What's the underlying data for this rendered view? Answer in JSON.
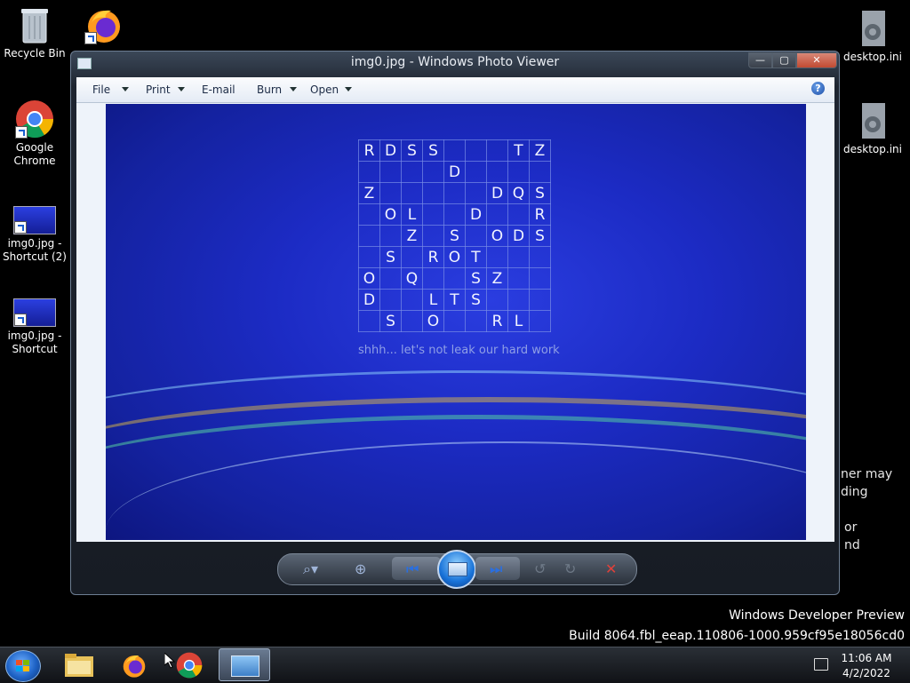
{
  "desktop": {
    "icons": [
      {
        "label": "Recycle Bin"
      },
      {
        "label": "Google Chrome"
      },
      {
        "label": "img0.jpg - Shortcut (2)"
      },
      {
        "label": "img0.jpg - Shortcut"
      },
      {
        "label": "desktop.ini"
      },
      {
        "label": "desktop.ini"
      }
    ],
    "background_fragments": [
      "ner may",
      "ding",
      "or",
      "nd"
    ],
    "watermark": {
      "line1": "Windows Developer Preview",
      "line2": "Build 8064.fbl_eeap.110806-1000.959cf95e18056cd0"
    }
  },
  "window": {
    "title": "img0.jpg - Windows Photo Viewer",
    "menu": [
      {
        "label": "File",
        "has_dropdown": true
      },
      {
        "label": "Print",
        "has_dropdown": true
      },
      {
        "label": "E-mail",
        "has_dropdown": false
      },
      {
        "label": "Burn",
        "has_dropdown": true
      },
      {
        "label": "Open",
        "has_dropdown": true
      }
    ],
    "help": "?",
    "controls": {
      "minimize": "—",
      "maximize": "▢",
      "close": "✕"
    }
  },
  "photo": {
    "grid": [
      [
        "R",
        "D",
        "S",
        "S",
        "",
        "",
        "",
        "T",
        "Z"
      ],
      [
        "",
        "",
        "",
        "",
        "D",
        "",
        "",
        "",
        ""
      ],
      [
        "Z",
        "",
        "",
        "",
        "",
        "",
        "D",
        "Q",
        "S"
      ],
      [
        "",
        "O",
        "L",
        "",
        "",
        "D",
        "",
        "",
        "R"
      ],
      [
        "",
        "",
        "Z",
        "",
        "S",
        "",
        "O",
        "D",
        "S"
      ],
      [
        "",
        "S",
        "",
        "R",
        "O",
        "T",
        "",
        "",
        ""
      ],
      [
        "O",
        "",
        "Q",
        "",
        "",
        "S",
        "Z",
        "",
        ""
      ],
      [
        "D",
        "",
        "",
        "L",
        "T",
        "S",
        "",
        "",
        ""
      ],
      [
        "",
        "S",
        "",
        "O",
        "",
        "",
        "R",
        "L",
        ""
      ]
    ],
    "caption": "shhh... let's not leak our hard work"
  },
  "taskbar": {
    "time": "11:06 AM",
    "date": "4/2/2022"
  }
}
